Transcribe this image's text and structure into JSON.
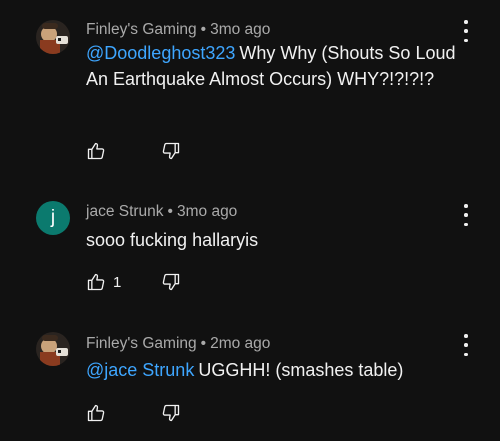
{
  "comments": [
    {
      "author": "Finley's Gaming",
      "age": "3mo ago",
      "avatar_icon": "gaming-avatar-icon",
      "mention": "@Doodleghost323",
      "text": "Why Why (Shouts So Loud An Earthquake Almost Occurs) WHY?!?!?!?",
      "like_count": ""
    },
    {
      "author": "jace Strunk",
      "age": "3mo ago",
      "avatar_letter": "j",
      "avatar_color": "#0b7a6e",
      "mention": "",
      "text": "sooo fucking hallaryis",
      "like_count": "1"
    },
    {
      "author": "Finley's Gaming",
      "age": "2mo ago",
      "avatar_icon": "gaming-avatar-icon",
      "mention": "@jace Strunk",
      "text": "UGGHH! (smashes table)",
      "like_count": ""
    }
  ],
  "meta_separator": "•",
  "colors": {
    "background": "#111111",
    "text": "#f1f1f1",
    "secondary_text": "#aaaaaa",
    "mention": "#3ea6ff"
  },
  "icons": [
    "gaming-avatar-icon",
    "thumbs-up-icon",
    "thumbs-down-icon",
    "more-vert-icon"
  ]
}
